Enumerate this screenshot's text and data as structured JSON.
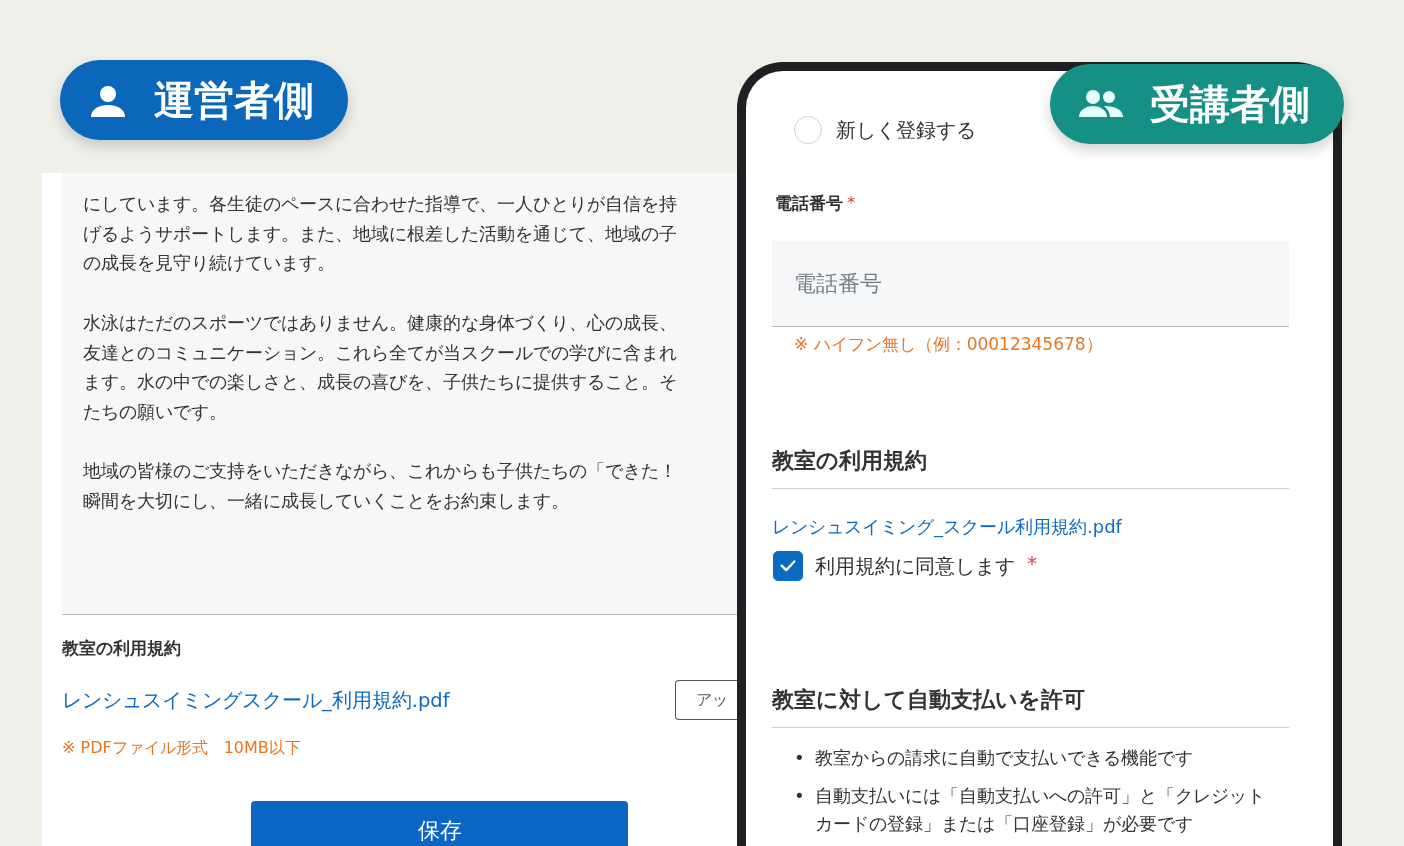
{
  "badges": [
    {
      "kind": "admin",
      "label": "運営者側"
    },
    {
      "kind": "student",
      "label": "受講者側"
    }
  ],
  "admin_panel": {
    "description_lines": [
      [
        "にしています。各生徒のペースに合わせた指導で、一人ひとりが自信を持",
        "げるようサポートします。また、地域に根差した活動を通じて、地域の子",
        "の成長を見守り続けています。"
      ],
      [
        "水泳はただのスポーツではありません。健康的な身体づくり、心の成長、",
        "友達とのコミュニケーション。これら全てが当スクールでの学びに含まれ",
        "ます。水の中での楽しさと、成長の喜びを、子供たちに提供すること。そ",
        "たちの願いです。"
      ],
      [
        "地域の皆様のご支持をいただきながら、これからも子供たちの「できた！",
        "瞬間を大切にし、一緒に成長していくことをお約束します。"
      ]
    ],
    "terms_label": "教室の利用規約",
    "terms_file": "レンシュスイミングスクール_利用規約.pdf",
    "upload_button": "アッ",
    "file_hint": "※ PDFファイル形式　10MB以下",
    "save_button": "保存"
  },
  "student_form": {
    "register_option": {
      "label": "新しく登録する",
      "selected": false
    },
    "phone_field": {
      "label": "電話番号",
      "required_mark": "*",
      "placeholder": "電話番号",
      "hint": "※ ハイフン無し（例：00012345678）"
    },
    "terms_section": {
      "heading": "教室の利用規約",
      "file_link": "レンシュスイミング_スクール利用規約.pdf",
      "agree": {
        "label": "利用規約に同意します",
        "required_mark": "*",
        "checked": true
      }
    },
    "autopay_section": {
      "heading": "教室に対して自動支払いを許可",
      "bullets": [
        {
          "marker": "•",
          "text": "教室からの請求に自動で支払いできる機能です"
        },
        {
          "marker": "•",
          "text": "自動支払いには「自動支払いへの許可」と「クレジットカードの登録」または「口座登録」が必要です"
        }
      ]
    }
  }
}
